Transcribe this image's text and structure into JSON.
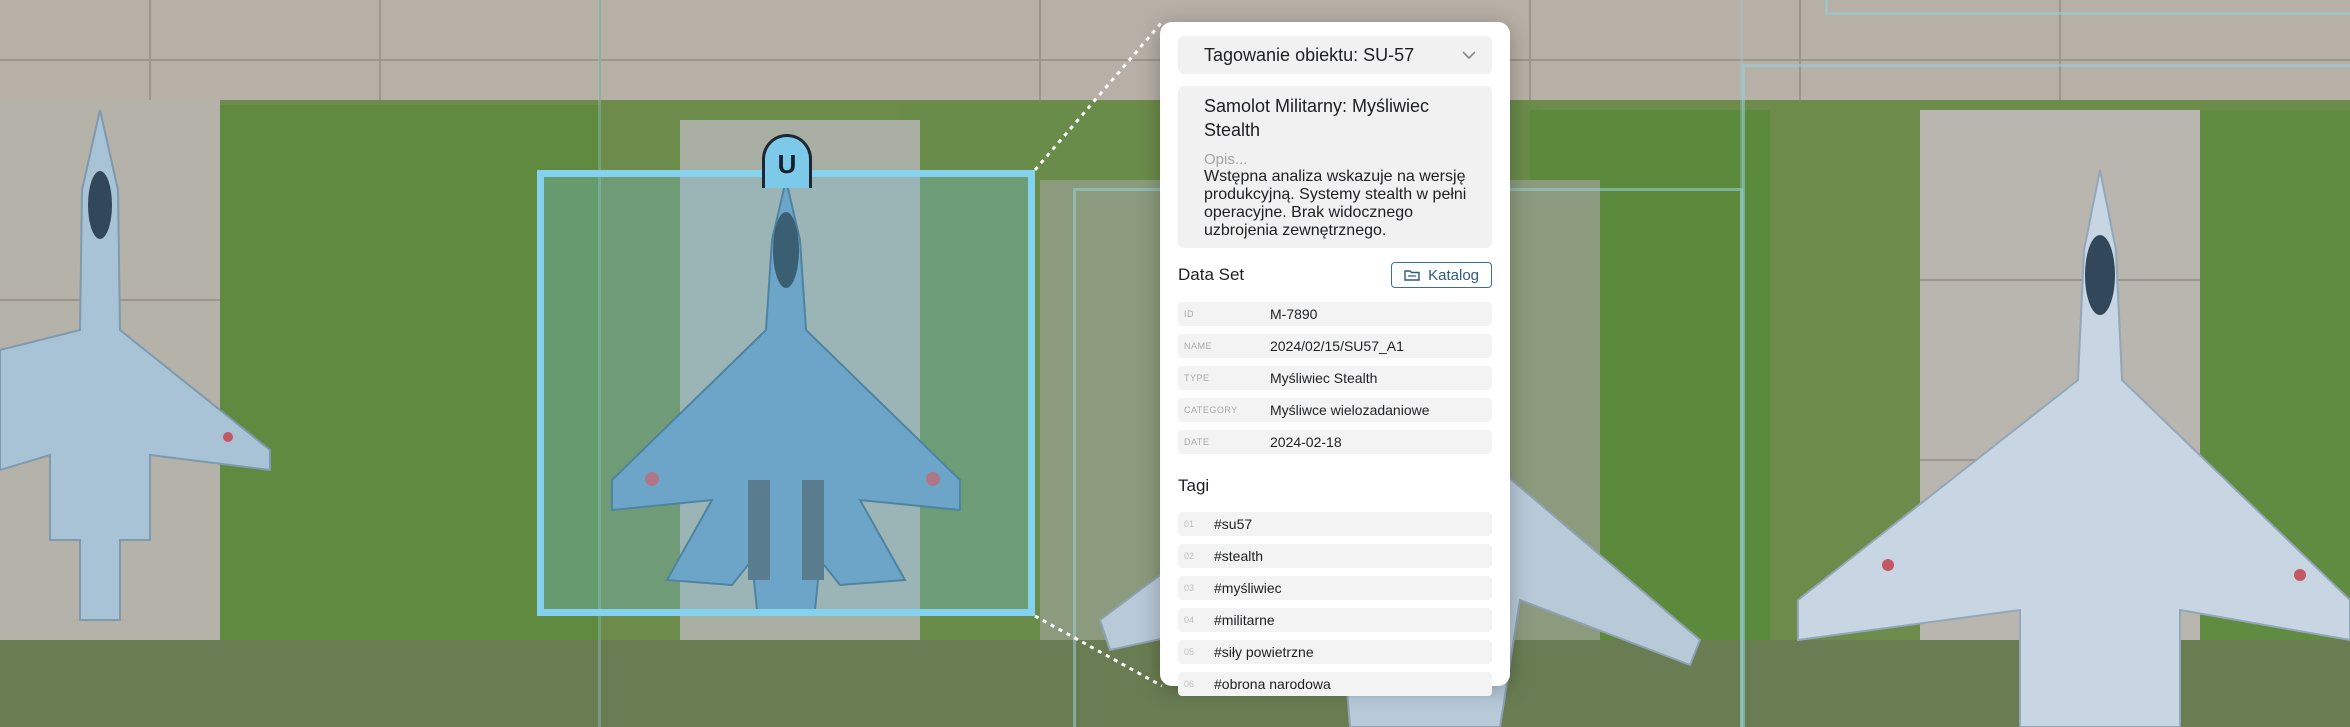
{
  "selection": {
    "handle_label": "U",
    "accent": "#85d2ef"
  },
  "panel": {
    "dropdown_label": "Tagowanie obiektu: SU-57",
    "description": {
      "title": "Samolot Militarny: Myśliwiec Stealth",
      "placeholder": "Opis...",
      "text": "Wstępna analiza wskazuje na wersję produkcyjną. Systemy stealth w pełni operacyjne. Brak widocznego uzbrojenia zewnętrznego."
    },
    "dataset": {
      "title": "Data Set",
      "catalog_button": "Katalog",
      "fields": [
        {
          "key": "ID",
          "value": "M-7890"
        },
        {
          "key": "NAME",
          "value": "2024/02/15/SU57_A1"
        },
        {
          "key": "TYPE",
          "value": "Myśliwiec Stealth"
        },
        {
          "key": "CATEGORY",
          "value": "Myśliwce wielozadaniowe"
        },
        {
          "key": "DATE",
          "value": "2024-02-18"
        }
      ]
    },
    "tags": {
      "title": "Tagi",
      "items": [
        {
          "n": "01",
          "label": "#su57"
        },
        {
          "n": "02",
          "label": "#stealth"
        },
        {
          "n": "03",
          "label": "#myśliwiec"
        },
        {
          "n": "04",
          "label": "#militarne"
        },
        {
          "n": "05",
          "label": "#siły powietrzne"
        },
        {
          "n": "06",
          "label": "#obrona narodowa"
        }
      ]
    }
  }
}
